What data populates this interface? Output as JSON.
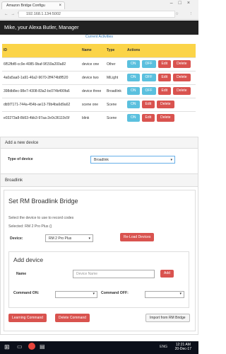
{
  "browser": {
    "tab_title": "Amazon Bridge Configu",
    "url": "192.168.1.134:5002"
  },
  "header": {
    "greeting": "Mike, your Alexa Butler, Manager",
    "current_activities": "Current Activities"
  },
  "devices_table": {
    "columns": [
      "ID",
      "Name",
      "Type",
      "Actions"
    ],
    "rows": [
      {
        "id": "6f52fbf8-cc9e-4085-9baf-9f159a200a82",
        "name": "device one",
        "type": "Other",
        "actions": [
          "ON",
          "OFF",
          "Edit",
          "Delete"
        ]
      },
      {
        "id": "4a0a5aa0-1a91-46a2-9670-2ff474b8f520",
        "name": "device two",
        "type": "MiLight",
        "actions": [
          "ON",
          "OFF",
          "Edit",
          "Delete"
        ]
      },
      {
        "id": "398db8ec-98e7-4308-83a2-bc074b490fa6",
        "name": "device three",
        "type": "Broadlink",
        "actions": [
          "ON",
          "OFF",
          "Edit",
          "Delete"
        ]
      },
      {
        "id": "db5f7171-744a-454b-ae13-79b4ba6d9a62",
        "name": "scene one",
        "type": "Scene",
        "actions": [
          "ON",
          "Edit",
          "Delete"
        ]
      },
      {
        "id": "e03273a8-8b53-4bb3-97aa-2e0c36119c5f",
        "name": "blink",
        "type": "Scene",
        "actions": [
          "ON",
          "Edit",
          "Delete"
        ]
      }
    ]
  },
  "add_device_panel": {
    "heading": "Add a new device",
    "type_label": "Type of device",
    "type_value": "Broadlink"
  },
  "broadlink_panel": {
    "heading": "Broadlink",
    "title": "Set RM Broadlink Bridge",
    "instruction": "Select the device to use to record codes",
    "selected": "Selected: RM 2 Pro Plus ()",
    "device_label": "Device:",
    "device_value": "RM 2 Pro Plus",
    "reload_button": "Re-Load Devices",
    "add_device_title": "Add device",
    "name_label": "Name",
    "name_placeholder": "Device Name",
    "add_button": "Add",
    "command_on_label": "Command ON:",
    "command_off_label": "Command OFF:",
    "learning_button": "Learning Command",
    "delete_command_button": "Delete Command",
    "import_button": "Import from RM Bridge"
  },
  "taskbar": {
    "time": "12:21 AM",
    "date": "20-Dec-17",
    "language": "ENG"
  },
  "colors": {
    "navbar": "#222222",
    "table_header": "#fbd448",
    "info_button": "#5bc0de",
    "danger_button": "#d9534f",
    "link": "#337ab7"
  }
}
